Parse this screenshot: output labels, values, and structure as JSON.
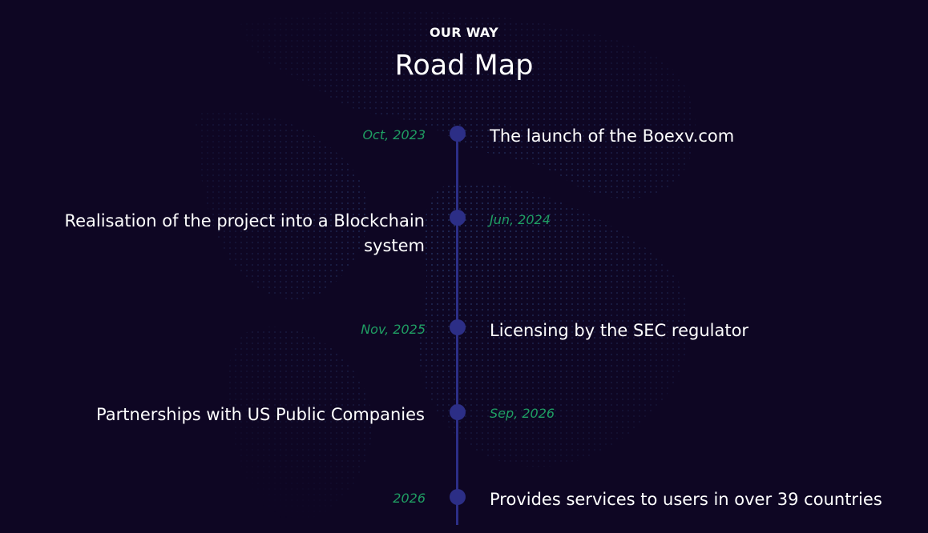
{
  "header": {
    "eyebrow": "OUR WAY",
    "title": "Road Map"
  },
  "roadmap": [
    {
      "date": "Oct, 2023",
      "text": "The launch of the Boexv.com"
    },
    {
      "date": "Jun, 2024",
      "text": "Realisation of the project into a Blockchain system"
    },
    {
      "date": "Nov, 2025",
      "text": "Licensing by the SEC regulator"
    },
    {
      "date": "Sep, 2026",
      "text": "Partnerships with US Public Companies"
    },
    {
      "date": "2026",
      "text": "Provides services to users in over 39 countries"
    }
  ],
  "colors": {
    "background": "#0e0623",
    "timeline": "#2c2e86",
    "date": "#1f9e63",
    "text": "#ffffff"
  }
}
